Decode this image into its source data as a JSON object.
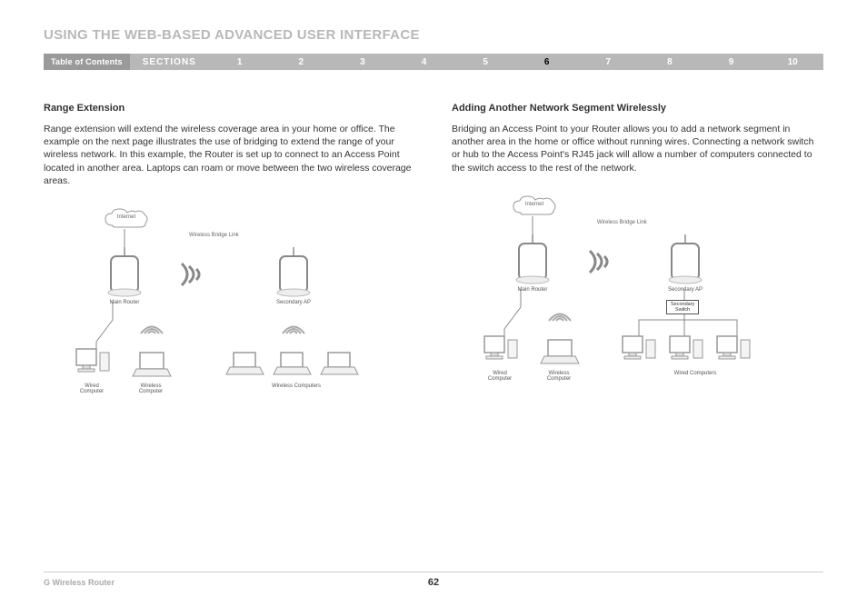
{
  "title": "USING THE WEB-BASED ADVANCED USER INTERFACE",
  "nav": {
    "toc": "Table of Contents",
    "sections": "SECTIONS",
    "items": [
      "1",
      "2",
      "3",
      "4",
      "5",
      "6",
      "7",
      "8",
      "9",
      "10"
    ],
    "active": "6"
  },
  "left": {
    "heading": "Range Extension",
    "body": "Range extension will extend the wireless coverage area in your home or office. The example on the next page illustrates the use of bridging to extend the range of your wireless network. In this example, the Router is set up to connect to an Access Point located in another area. Laptops can roam or move between the two wireless coverage areas.",
    "diagram": {
      "internet": "Internet",
      "main_router": "Main Router",
      "bridge": "Wireless Bridge Link",
      "secondary_ap": "Secondary AP",
      "wired_computer": "Wired\nComputer",
      "wireless_computer": "Wireless\nComputer",
      "wireless_computers": "Wireless Computers"
    }
  },
  "right": {
    "heading": "Adding Another Network Segment Wirelessly",
    "body": "Bridging an Access Point to your Router allows you to add a network segment in another area in the home or office without running wires. Connecting a network switch or hub to the Access Point's RJ45 jack will allow a number of computers connected to the switch access to the rest of the network.",
    "diagram": {
      "internet": "Internet",
      "main_router": "Main Router",
      "bridge": "Wireless Bridge Link",
      "secondary_ap": "Secondary AP",
      "secondary_switch": "Secondary\nSwitch",
      "wired_computer": "Wired\nComputer",
      "wireless_computer": "Wireless\nComputer",
      "wired_computers": "Wired Computers"
    }
  },
  "footer": {
    "product": "G Wireless Router",
    "page": "62"
  }
}
